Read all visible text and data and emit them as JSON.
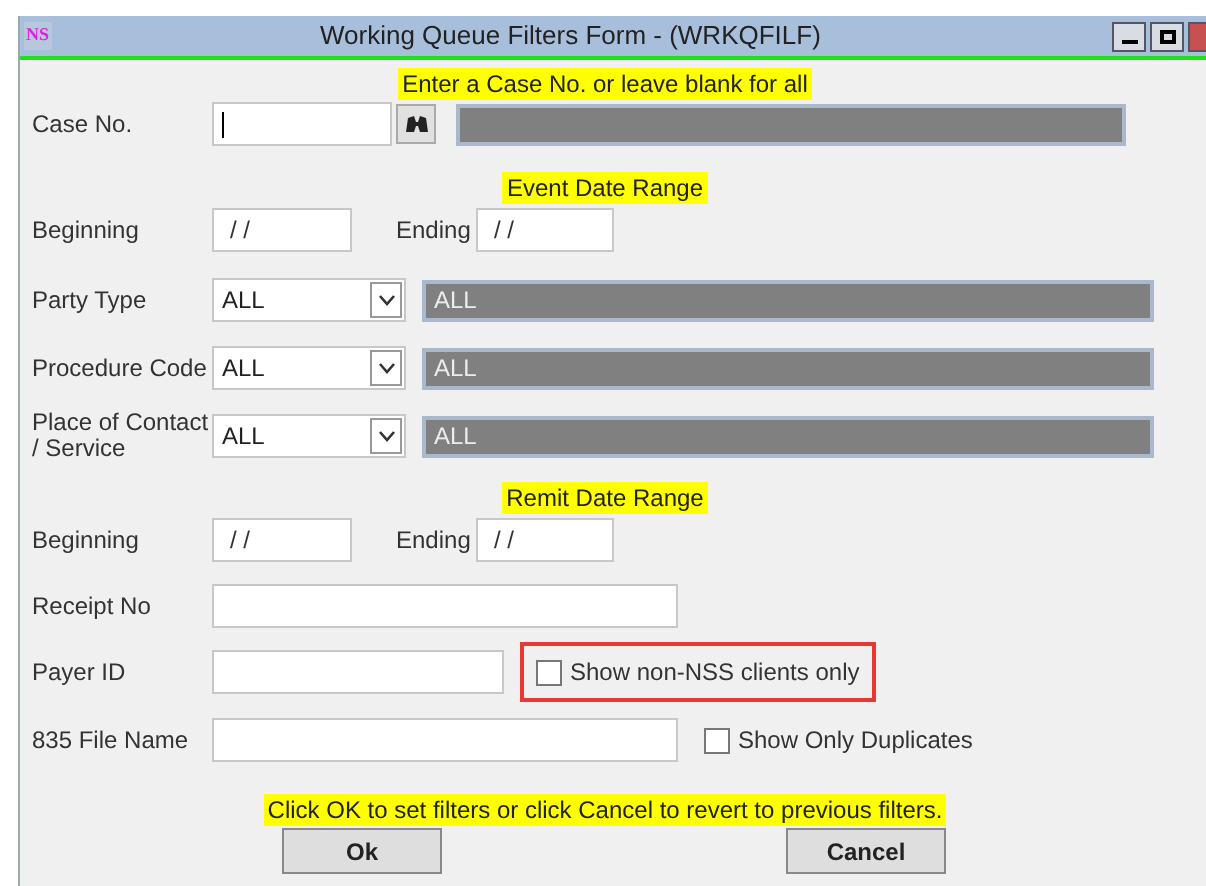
{
  "window": {
    "title": "Working Queue Filters Form - (WRKQFILF)",
    "app_badge": "NS"
  },
  "case_hint": "Enter a Case No. or leave blank for all",
  "case_no": {
    "label": "Case No.",
    "focused": true
  },
  "event_range": {
    "heading": "Event Date Range",
    "beginning": {
      "label": "Beginning",
      "value": "/ /"
    },
    "ending": {
      "label": "Ending",
      "value": "/ /"
    }
  },
  "dropdowns": [
    {
      "label": "Party Type",
      "value": "ALL",
      "description": "ALL"
    },
    {
      "label": "Procedure Code",
      "value": "ALL",
      "description": "ALL"
    },
    {
      "label": "Place of Contact / Service",
      "value": "ALL",
      "description": "ALL"
    }
  ],
  "remit_range": {
    "heading": "Remit Date Range",
    "beginning": {
      "label": "Beginning",
      "value": "/ /"
    },
    "ending": {
      "label": "Ending",
      "value": "/ /"
    }
  },
  "receipt_no": {
    "label": "Receipt No"
  },
  "payer_id": {
    "label": "Payer ID",
    "option": {
      "label": "Show non-NSS clients only",
      "checked": false,
      "highlighted": true
    }
  },
  "file_name": {
    "label": "835 File Name",
    "option": {
      "label": "Show Only Duplicates",
      "checked": false,
      "highlighted": false
    }
  },
  "footer_hint": "Click OK to set filters or click Cancel to revert to previous filters.",
  "buttons": [
    "Ok",
    "Cancel"
  ]
}
